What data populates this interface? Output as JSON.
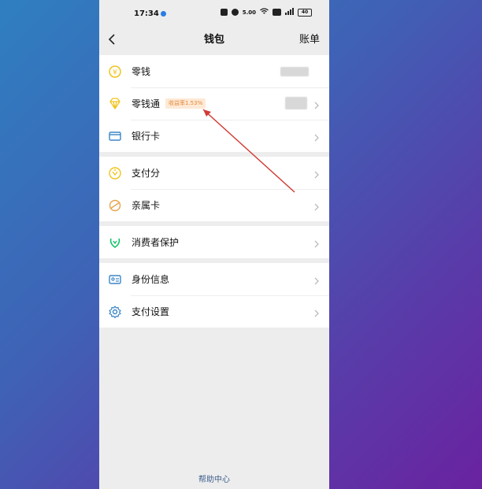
{
  "status_bar": {
    "time": "17:34",
    "network_speed": "5.00",
    "battery": "40"
  },
  "nav": {
    "title": "钱包",
    "right_action": "账单"
  },
  "groups": [
    {
      "items": [
        {
          "label": "零钱",
          "icon": "coin-icon"
        },
        {
          "label": "零钱通",
          "icon": "diamond-icon",
          "badge": "收益率1.53%"
        },
        {
          "label": "银行卡",
          "icon": "card-icon"
        }
      ]
    },
    {
      "items": [
        {
          "label": "支付分",
          "icon": "score-icon"
        },
        {
          "label": "亲属卡",
          "icon": "family-card-icon"
        }
      ]
    },
    {
      "items": [
        {
          "label": "消费者保护",
          "icon": "protect-icon"
        }
      ]
    },
    {
      "items": [
        {
          "label": "身份信息",
          "icon": "id-icon"
        },
        {
          "label": "支付设置",
          "icon": "gear-icon"
        }
      ]
    }
  ],
  "footer": {
    "help": "帮助中心"
  },
  "colors": {
    "accent_green": "#07c160",
    "icon_yellow": "#f0c419",
    "icon_blue": "#3a86c8",
    "badge_bg": "#fde9d6",
    "badge_text": "#e58a3a",
    "annotation": "#d23b35"
  }
}
